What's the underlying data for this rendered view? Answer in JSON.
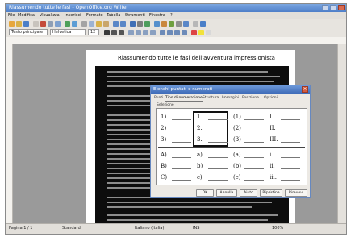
{
  "window": {
    "title": "Riassumendo tutte le fasi - OpenOffice.org Writer"
  },
  "menu": [
    "File",
    "Modifica",
    "Visualizza",
    "Inserisci",
    "Formato",
    "Tabella",
    "Strumenti",
    "Finestra",
    "?"
  ],
  "format_bar": {
    "style": "Testo principale",
    "font": "Helvetica",
    "size": "12"
  },
  "document": {
    "heading": "Riassumendo tutte le fasi dell'avventura impressionista"
  },
  "dialog": {
    "title": "Elenchi puntati e numerati",
    "tabs": [
      "Punti",
      "Tipo di numerazione",
      "Struttura",
      "Immagini",
      "Posizione",
      "Opzioni"
    ],
    "active_tab": "Tipo di numerazione",
    "section_label": "Selezione",
    "grid": [
      [
        "1)",
        "1.",
        "(1)",
        "I."
      ],
      [
        "2)",
        "2.",
        "(2)",
        "II."
      ],
      [
        "3)",
        "3.",
        "(3)",
        "III."
      ],
      [
        "A)",
        "a)",
        "(a)",
        "i."
      ],
      [
        "B)",
        "b)",
        "(b)",
        "ii."
      ],
      [
        "C)",
        "c)",
        "(c)",
        "iii."
      ]
    ],
    "buttons": {
      "ok": "OK",
      "cancel": "Annulla",
      "help": "Aiuto",
      "reset": "Ripristina",
      "remove": "Rimuovi"
    }
  },
  "status": {
    "page": "Pagina 1 / 1",
    "style": "Standard",
    "lang": "Italiano (Italia)",
    "mode": "INS",
    "zoom": "100%"
  }
}
